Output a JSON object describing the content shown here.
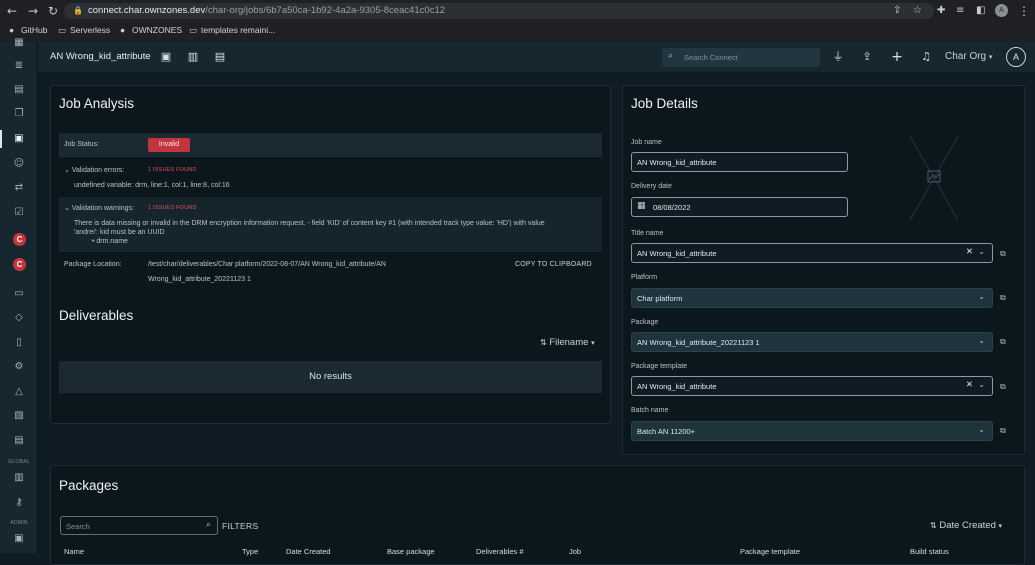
{
  "browser": {
    "url_host": "connect.char.ownzones.dev",
    "url_path": "/char-org/jobs/6b7a50ca-1b92-4a2a-9305-8ceac41c0c12",
    "bookmarks": [
      "GitHub",
      "Serverless",
      "OWNZONES",
      "templates remaini..."
    ]
  },
  "rail": {
    "section_global": "GLOBAL",
    "section_admin": "ADMIN"
  },
  "topbar": {
    "job_title": "AN Wrong_kid_attribute",
    "search_placeholder": "Search Connect",
    "org": "Char Org",
    "avatar_letter": "A"
  },
  "analysis": {
    "title": "Job Analysis",
    "status_label": "Job Status:",
    "status_value": "Invalid",
    "errors_label": "Validation errors:",
    "errors_count": "1 ISSUES FOUND",
    "error_text": "undefined variable: drm, line:1, col:1, line:8, col:16",
    "warnings_label": "Validation warnings:",
    "warnings_count": "1 ISSUES FOUND",
    "warning_text_1": "There is data missing or invalid in the DRM encryption information request. - field 'KID' of content key #1 (with intended track type value: 'HD') with value",
    "warning_text_2": "'andrei': kid must be an UUID",
    "warning_bullet": "drm.name",
    "location_label": "Package Location:",
    "location_line1": "/test/char/deliverables/Char platform/2022-08-07/AN Wrong_kid_attribute/AN",
    "location_line2": "Wrong_kid_attribute_20221123 1",
    "copy_label": "COPY TO CLIPBOARD"
  },
  "deliverables": {
    "title": "Deliverables",
    "sort_label": "Filename",
    "empty": "No results"
  },
  "details": {
    "title": "Job Details",
    "job_name_label": "Job name",
    "job_name_value": "AN Wrong_kid_attribute",
    "delivery_date_label": "Delivery date",
    "delivery_date_value": "08/08/2022",
    "title_name_label": "Title name",
    "title_name_value": "AN Wrong_kid_attribute",
    "platform_label": "Platform",
    "platform_value": "Char platform",
    "package_label": "Package",
    "package_value": "AN Wrong_kid_attribute_20221123 1",
    "package_template_label": "Package template",
    "package_template_value": "AN Wrong_kid_attribute",
    "batch_label": "Batch name",
    "batch_value": "Batch AN 11200+"
  },
  "packages": {
    "title": "Packages",
    "search_placeholder": "Search",
    "filters_label": "FILTERS",
    "sort_label": "Date Created",
    "columns": [
      "Name",
      "Type",
      "Date Created",
      "Base package",
      "Deliverables #",
      "Job",
      "Package template",
      "Build status"
    ]
  }
}
